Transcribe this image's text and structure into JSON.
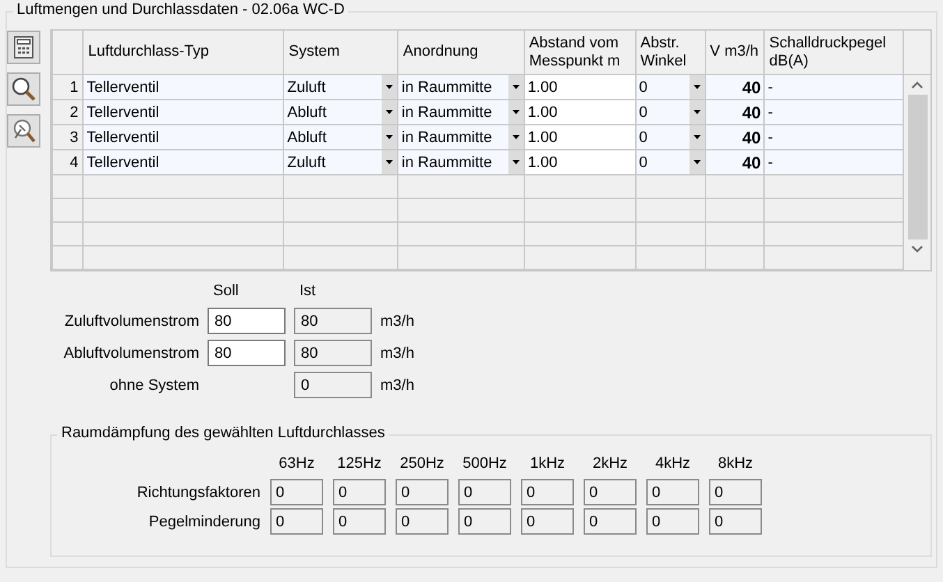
{
  "group_title": "Luftmengen und Durchlassdaten - 02.06a WC-D",
  "table": {
    "columns": [
      "Luftdurchlass-Typ",
      "System",
      "Anordnung",
      "Abstand vom Messpunkt m",
      "Abstr. Winkel",
      "V m3/h",
      "Schalldruckpegel dB(A)"
    ],
    "rows": [
      {
        "number": "1",
        "type": "Tellerventil",
        "system": "Zuluft",
        "arrangement": "in Raummitte",
        "distance": "1.00",
        "angle": "0",
        "volume": "40",
        "sound": "-"
      },
      {
        "number": "2",
        "type": "Tellerventil",
        "system": "Abluft",
        "arrangement": "in Raummitte",
        "distance": "1.00",
        "angle": "0",
        "volume": "40",
        "sound": "-"
      },
      {
        "number": "3",
        "type": "Tellerventil",
        "system": "Abluft",
        "arrangement": "in Raummitte",
        "distance": "1.00",
        "angle": "0",
        "volume": "40",
        "sound": "-"
      },
      {
        "number": "4",
        "type": "Tellerventil",
        "system": "Zuluft",
        "arrangement": "in Raummitte",
        "distance": "1.00",
        "angle": "0",
        "volume": "40",
        "sound": "-"
      }
    ]
  },
  "flows": {
    "soll_label": "Soll",
    "ist_label": "Ist",
    "rows": [
      {
        "label": "Zuluftvolumenstrom",
        "soll": "80",
        "ist": "80",
        "unit": "m3/h"
      },
      {
        "label": "Abluftvolumenstrom",
        "soll": "80",
        "ist": "80",
        "unit": "m3/h"
      },
      {
        "label": "ohne System",
        "ist": "0",
        "unit": "m3/h"
      }
    ]
  },
  "damping": {
    "title": "Raumdämpfung des gewählten Luftdurchlasses",
    "bands": [
      "63Hz",
      "125Hz",
      "250Hz",
      "500Hz",
      "1kHz",
      "2kHz",
      "4kHz",
      "8kHz"
    ],
    "rows": [
      {
        "label": "Richtungsfaktoren",
        "values": [
          "0",
          "0",
          "0",
          "0",
          "0",
          "0",
          "0",
          "0"
        ]
      },
      {
        "label": "Pegelminderung",
        "values": [
          "0",
          "0",
          "0",
          "0",
          "0",
          "0",
          "0",
          "0"
        ]
      }
    ]
  }
}
